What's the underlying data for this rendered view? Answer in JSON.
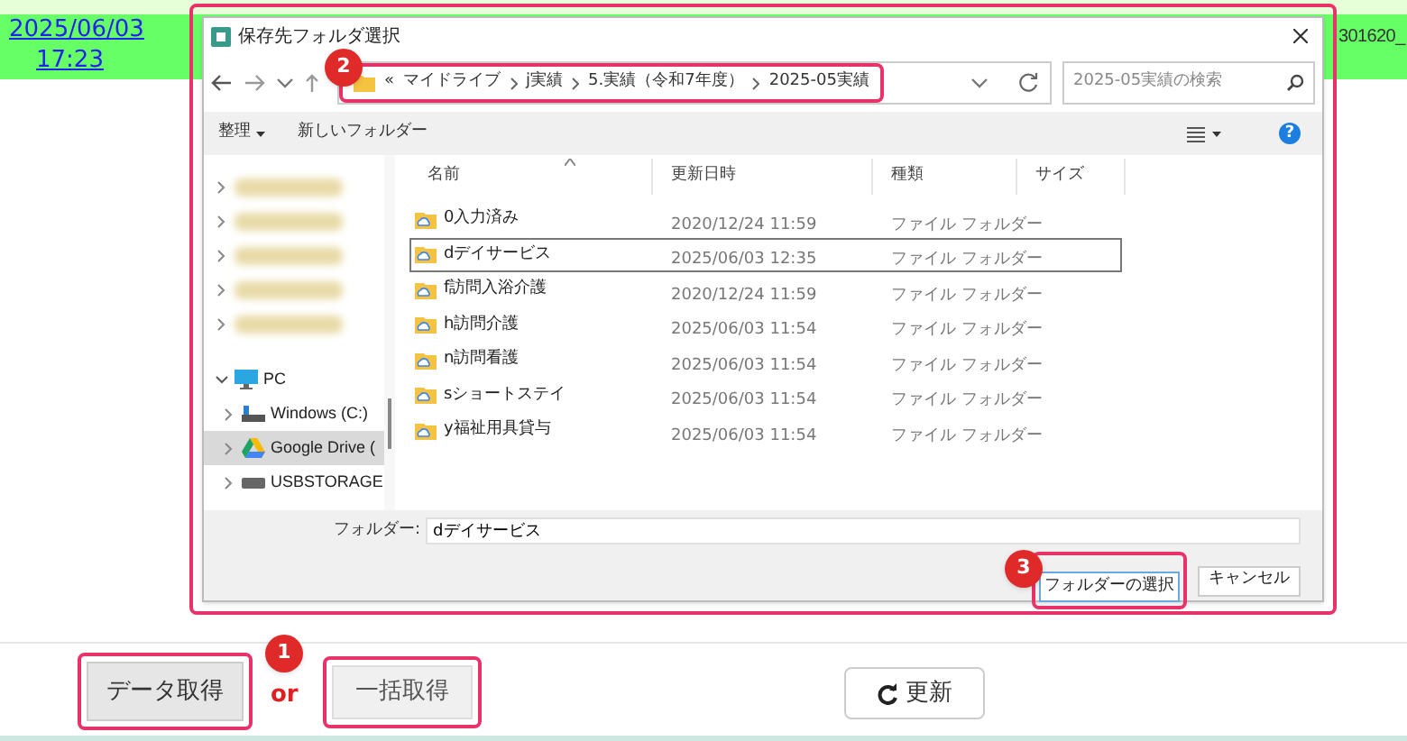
{
  "page": {
    "date": "2025/06/03",
    "time": "17:23",
    "right_text": "301620_"
  },
  "dialog": {
    "title": "保存先フォルダ選択",
    "address": [
      "«",
      "マイドライブ",
      "j実績",
      "5.実績（令和7年度）",
      "2025-05実績"
    ],
    "search": {
      "placeholder": "2025-05実績の検索"
    },
    "toolbar": {
      "organize": "整理",
      "new_folder": "新しいフォルダー",
      "help": "?"
    },
    "sidebar": [
      {
        "kind": "blurred",
        "selected": false
      },
      {
        "kind": "blurred",
        "selected": false
      },
      {
        "kind": "blurred",
        "selected": false
      },
      {
        "kind": "blurred",
        "selected": false
      },
      {
        "kind": "blurred",
        "selected": false
      },
      {
        "kind": "pc",
        "label": "PC",
        "selected": false,
        "expanded": true,
        "children": [
          {
            "kind": "drive",
            "label": "Windows (C:)",
            "selected": false,
            "expanded": false
          },
          {
            "kind": "gdrive",
            "label": "Google Drive (",
            "selected": true,
            "expanded": false
          },
          {
            "kind": "usb",
            "label": "USBSTORAGE",
            "selected": false,
            "expanded": false
          }
        ]
      }
    ],
    "columns": [
      "名前",
      "更新日時",
      "種類",
      "サイズ"
    ],
    "rows": [
      {
        "name": "0入力済み",
        "date": "2020/12/24 11:59",
        "type": "ファイル フォルダー",
        "selected": false
      },
      {
        "name": "dデイサービス",
        "date": "2025/06/03 12:35",
        "type": "ファイル フォルダー",
        "selected": true
      },
      {
        "name": "f訪問入浴介護",
        "date": "2020/12/24 11:59",
        "type": "ファイル フォルダー",
        "selected": false
      },
      {
        "name": "h訪問介護",
        "date": "2025/06/03 11:54",
        "type": "ファイル フォルダー",
        "selected": false
      },
      {
        "name": "n訪問看護",
        "date": "2025/06/03 11:54",
        "type": "ファイル フォルダー",
        "selected": false
      },
      {
        "name": "sショートステイ",
        "date": "2025/06/03 11:54",
        "type": "ファイル フォルダー",
        "selected": false
      },
      {
        "name": "y福祉用具貸与",
        "date": "2025/06/03 11:54",
        "type": "ファイル フォルダー",
        "selected": false
      }
    ],
    "folder_field": {
      "label": "フォルダー:",
      "value": "dデイサービス"
    },
    "buttons": {
      "select": "フォルダーの選択",
      "cancel": "キャンセル"
    }
  },
  "actions": {
    "fetch": "データ取得",
    "or": "or",
    "bulk": "一括取得",
    "refresh": "更新"
  },
  "badges": [
    "1",
    "2",
    "3"
  ]
}
